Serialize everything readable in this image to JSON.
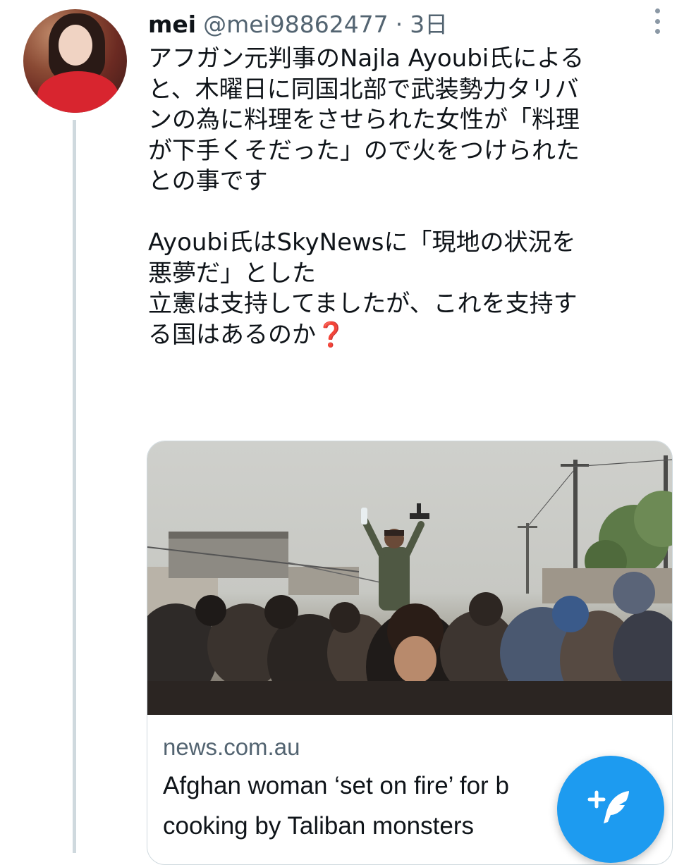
{
  "tweet": {
    "display_name": "mei",
    "handle": "@mei98862477",
    "separator": "·",
    "time": "3日",
    "text_lines": [
      "アフガン元判事のNajla Ayoubi氏による",
      "と、木曜日に同国北部で武装勢力タリバ",
      "ンの為に料理をさせられた女性が「料理",
      "が下手くそだった」ので火をつけられた",
      "との事です",
      "",
      "Ayoubi氏はSkyNewsに「現地の状況を",
      "悪夢だ」とした",
      "立憲は支持してましたが、これを支持す",
      "る国はあるのか"
    ],
    "question_emoji": "❓"
  },
  "card": {
    "domain": "news.com.au",
    "title_line1": "Afghan woman ‘set on fire’ for b",
    "title_line2": "cooking by Taliban monsters"
  },
  "icons": {
    "more": "more-vertical-icon",
    "compose": "compose-tweet-icon"
  },
  "colors": {
    "accent": "#1d9bf0",
    "secondary_text": "#536471",
    "thread_line": "#cfd9de"
  }
}
